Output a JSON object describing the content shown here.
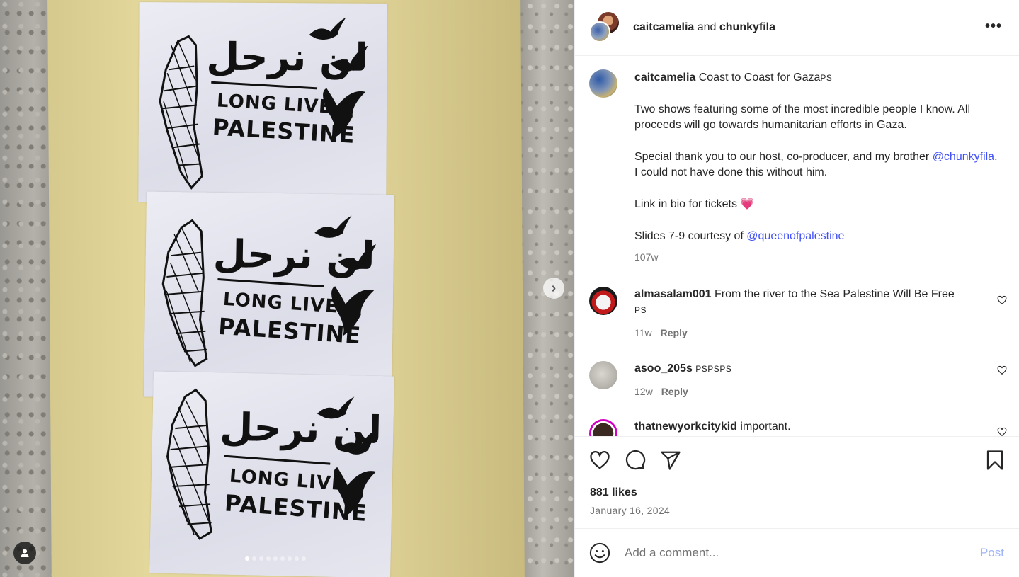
{
  "post": {
    "header": {
      "user1": "caitcamelia",
      "and": " and ",
      "user2": "chunkyfila",
      "more": "•••"
    },
    "photo": {
      "poster_arabic": "لن نرحل",
      "poster_line1": "LONG LIVE",
      "poster_line2": "PALESTINE",
      "next_icon": "chevron-right-icon",
      "slides_total": 9,
      "slide_active": 1
    },
    "caption": {
      "username": "caitcamelia",
      "title": " Coast to Coast for Gaza",
      "title_suffix": "PS",
      "p1": "Two shows featuring some of the most incredible people I know. All proceeds will go towards humanitarian efforts in Gaza.",
      "p2_before": "Special thank you to our host, co-producer, and my brother ",
      "p2_mention": "@chunkyfila",
      "p2_after": ". I could not have done this without him.",
      "p3": "Link in bio for tickets 💗",
      "p4_before": "Slides 7-9 courtesy of ",
      "p4_mention": "@queenofpalestine",
      "time": "107w"
    },
    "comments": [
      {
        "username": "almasalam001",
        "text": " From the river to the Sea Palestine Will Be Free",
        "suffix": "PS",
        "time": "11w",
        "reply": "Reply"
      },
      {
        "username": "asoo_205s",
        "text": " ",
        "suffix": "PSPSPS",
        "time": "12w",
        "reply": "Reply"
      },
      {
        "username": "thatnewyorkcitykid",
        "text": " important.",
        "suffix": "",
        "time": "",
        "reply": ""
      }
    ],
    "likes": "881 likes",
    "date": "January 16, 2024",
    "composer": {
      "placeholder": "Add a comment...",
      "post": "Post"
    },
    "colors": {
      "link": "#4150f7",
      "post_disabled": "#9fb5f7",
      "muted": "#737373"
    }
  }
}
